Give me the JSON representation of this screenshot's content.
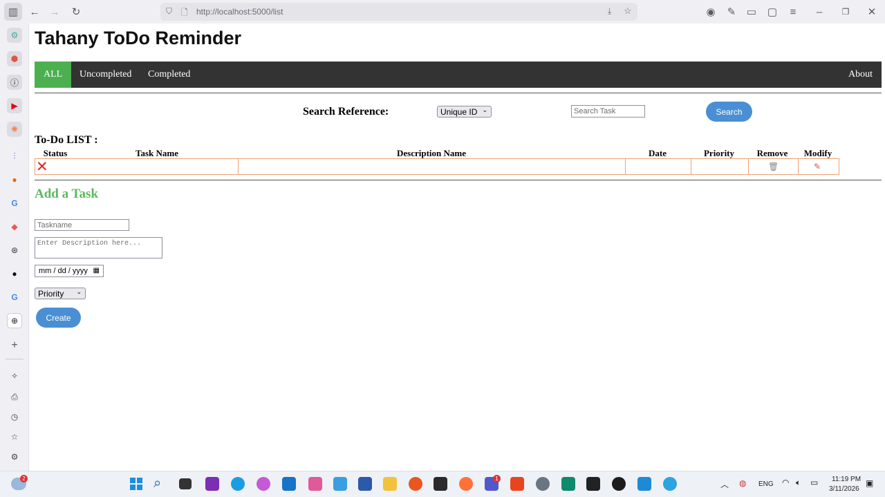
{
  "browser": {
    "url": "http://localhost:5000/list"
  },
  "app": {
    "title": "Tahany ToDo Reminder"
  },
  "nav": {
    "all": "ALL",
    "uncompleted": "Uncompleted",
    "completed": "Completed",
    "about": "About"
  },
  "search": {
    "label": "Search Reference:",
    "select_value": "Unique ID",
    "input_placeholder": "Search Task",
    "button_label": "Search"
  },
  "todo_list": {
    "title": "To-Do LIST :",
    "columns": [
      "Status",
      "Task Name",
      "Description Name",
      "Date",
      "Priority",
      "Remove",
      "Modify"
    ],
    "rows": [
      {
        "status": "not-completed",
        "task_name": "",
        "description": "",
        "date": "",
        "priority": ""
      }
    ]
  },
  "add_task": {
    "title": "Add a Task",
    "taskname_placeholder": "Taskname",
    "description_placeholder": "Enter Description here...",
    "date_placeholder": "mm / dd / yyyy",
    "priority_value": "Priority",
    "create_label": "Create"
  },
  "taskbar": {
    "language": "ENG",
    "time": "11:19 PM",
    "date": "3/11/2026",
    "weather_badge": "2",
    "teams_badge": "1"
  },
  "colors": {
    "nav_bg": "#333333",
    "nav_active": "#4caf50",
    "accent_button": "#4a8fd4",
    "add_title": "#5cb85c",
    "row_border": "#f0a070"
  }
}
